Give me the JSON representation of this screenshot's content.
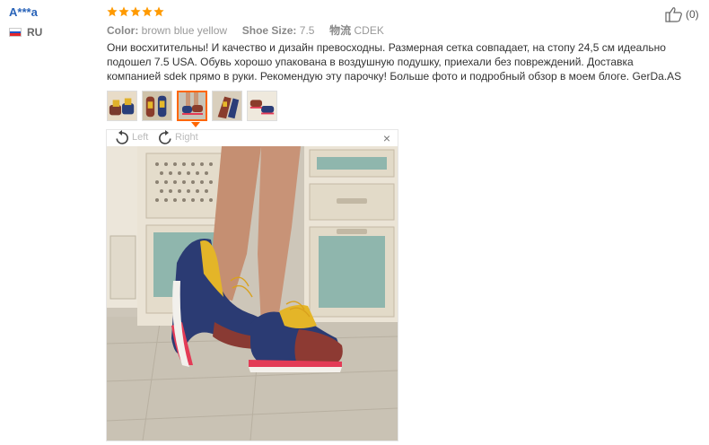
{
  "reviewer": {
    "name": "A***a",
    "country": "RU",
    "flag_colors": [
      "#ffffff",
      "#1f55c7",
      "#e3262a"
    ]
  },
  "rating": {
    "stars": 5,
    "color": "#ff9a00"
  },
  "attributes": {
    "color_label": "Color:",
    "color_value": "brown blue yellow",
    "size_label": "Shoe Size:",
    "size_value": "7.5",
    "shipping_label": "物流",
    "shipping_value": "CDEK"
  },
  "review": {
    "text": "Они восхитительны! И качество и дизайн превосходны. Размерная сетка совпадает, на стопу 24,5 см идеально подошел 7.5 USA. Обувь хорошо упакована в воздушную подушку, приехали без повреждений. Доставка компанией sdek прямо в руки. Рекомендую эту парочку! Больше фото и подробный обзор в моем блоге. GerDa.AS"
  },
  "thumbnails": {
    "count": 5,
    "active_index": 2
  },
  "viewer": {
    "rotate_left_label": "Left",
    "rotate_right_label": "Right",
    "close_label": "×"
  },
  "helpful": {
    "count_text": "(0)"
  }
}
